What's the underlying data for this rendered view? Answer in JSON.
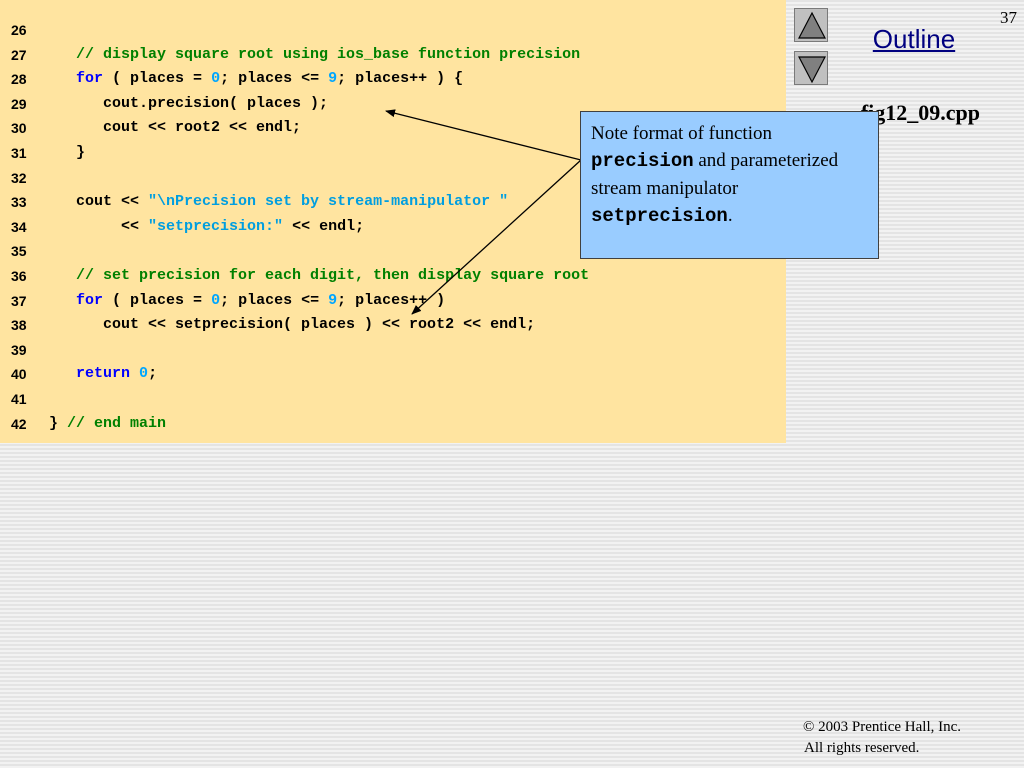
{
  "slide": {
    "page_number": "37"
  },
  "outline": {
    "label": "Outline"
  },
  "file": {
    "name": "fig12_09.cpp"
  },
  "code_lines": [
    {
      "num": "26",
      "tokens": []
    },
    {
      "num": "27",
      "tokens": [
        {
          "t": "   // display square root using ios_base function precision",
          "c": "comment"
        }
      ]
    },
    {
      "num": "28",
      "tokens": [
        {
          "t": "   ",
          "c": "plain"
        },
        {
          "t": "for",
          "c": "kw"
        },
        {
          "t": " ( places = ",
          "c": "plain"
        },
        {
          "t": "0",
          "c": "num"
        },
        {
          "t": "; places <= ",
          "c": "plain"
        },
        {
          "t": "9",
          "c": "num"
        },
        {
          "t": "; places++ ) {",
          "c": "plain"
        }
      ]
    },
    {
      "num": "29",
      "tokens": [
        {
          "t": "      cout.precision( places );",
          "c": "plain"
        }
      ]
    },
    {
      "num": "30",
      "tokens": [
        {
          "t": "      cout << root2 << endl;",
          "c": "plain"
        }
      ]
    },
    {
      "num": "31",
      "tokens": [
        {
          "t": "   }",
          "c": "plain"
        }
      ]
    },
    {
      "num": "32",
      "tokens": []
    },
    {
      "num": "33",
      "tokens": [
        {
          "t": "   cout << ",
          "c": "plain"
        },
        {
          "t": "\"\\nPrecision set by stream-manipulator \"",
          "c": "str"
        }
      ]
    },
    {
      "num": "34",
      "tokens": [
        {
          "t": "        << ",
          "c": "plain"
        },
        {
          "t": "\"setprecision:\"",
          "c": "str"
        },
        {
          "t": " << endl;",
          "c": "plain"
        }
      ]
    },
    {
      "num": "35",
      "tokens": []
    },
    {
      "num": "36",
      "tokens": [
        {
          "t": "   // set precision for each digit, then display square root",
          "c": "comment"
        }
      ]
    },
    {
      "num": "37",
      "tokens": [
        {
          "t": "   ",
          "c": "plain"
        },
        {
          "t": "for",
          "c": "kw"
        },
        {
          "t": " ( places = ",
          "c": "plain"
        },
        {
          "t": "0",
          "c": "num"
        },
        {
          "t": "; places <= ",
          "c": "plain"
        },
        {
          "t": "9",
          "c": "num"
        },
        {
          "t": "; places++ )",
          "c": "plain"
        }
      ]
    },
    {
      "num": "38",
      "tokens": [
        {
          "t": "      cout << setprecision( places ) << root2 << endl;",
          "c": "plain"
        }
      ]
    },
    {
      "num": "39",
      "tokens": []
    },
    {
      "num": "40",
      "tokens": [
        {
          "t": "   ",
          "c": "plain"
        },
        {
          "t": "return",
          "c": "kw"
        },
        {
          "t": " ",
          "c": "plain"
        },
        {
          "t": "0",
          "c": "num"
        },
        {
          "t": ";",
          "c": "plain"
        }
      ]
    },
    {
      "num": "41",
      "tokens": []
    },
    {
      "num": "42",
      "tokens": [
        {
          "t": "} ",
          "c": "plain"
        },
        {
          "t": "// end main",
          "c": "comment"
        }
      ]
    }
  ],
  "callout": {
    "text_1": "Note format of function ",
    "code_1": "precision",
    "text_2": " and parameterized stream manipulator ",
    "code_2": "setprecision",
    "text_3": "."
  },
  "copyright": {
    "line1": "© 2003 Prentice Hall, Inc.",
    "line2": "All rights reserved."
  },
  "colors": {
    "code_background": "#ffe4a0",
    "keyword": "#0000ff",
    "comment": "#008000",
    "string_literal": "#009ee0",
    "number_literal": "#00a6ff",
    "callout_background": "#99ccff",
    "outline_link": "#000080"
  },
  "icons": {
    "nav_up": "triangle-up-icon",
    "nav_down": "triangle-down-icon"
  }
}
